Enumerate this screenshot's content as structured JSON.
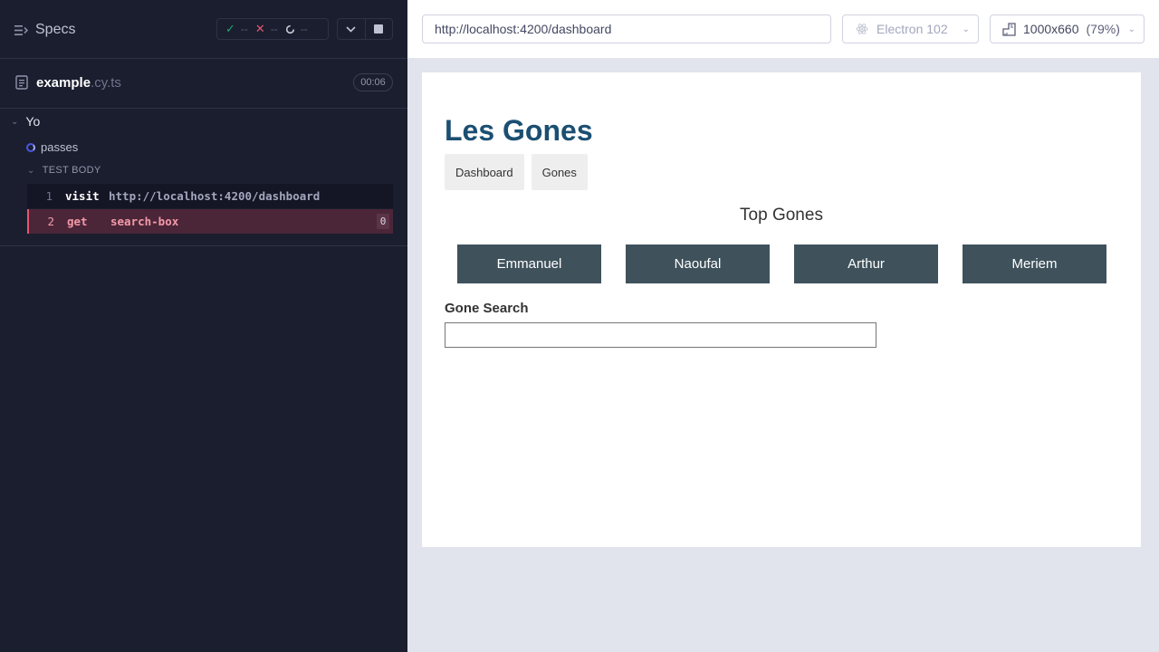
{
  "reporter": {
    "specs_label": "Specs",
    "stats": {
      "passed_icon": "✓",
      "passed": "--",
      "failed_icon": "✕",
      "failed": "--",
      "pending": "--"
    },
    "spec": {
      "name": "example",
      "ext": ".cy.ts",
      "duration": "00:06"
    },
    "suite": {
      "title": "Yo"
    },
    "test": {
      "title": "passes"
    },
    "section": {
      "title": "TEST BODY"
    },
    "commands": [
      {
        "num": "1",
        "name": "visit",
        "message": "http://localhost:4200/dashboard",
        "count": ""
      },
      {
        "num": "2",
        "name": "get",
        "message": "search-box",
        "count": "0"
      }
    ],
    "colors": {
      "pass": "#1fa971",
      "fail": "#e45770",
      "running": "#4956e3"
    }
  },
  "aut": {
    "url": "http://localhost:4200/dashboard",
    "browser": "Electron 102",
    "viewport": "1000x660",
    "scale": "(79%)"
  },
  "app": {
    "title": "Les Gones",
    "nav": [
      "Dashboard",
      "Gones"
    ],
    "top_heading": "Top Gones",
    "gones": [
      "Emmanuel",
      "Naoufal",
      "Arthur",
      "Meriem"
    ],
    "search_label": "Gone Search",
    "search_value": "",
    "colors": {
      "title": "#1b4f72",
      "card": "#3f525c"
    }
  }
}
